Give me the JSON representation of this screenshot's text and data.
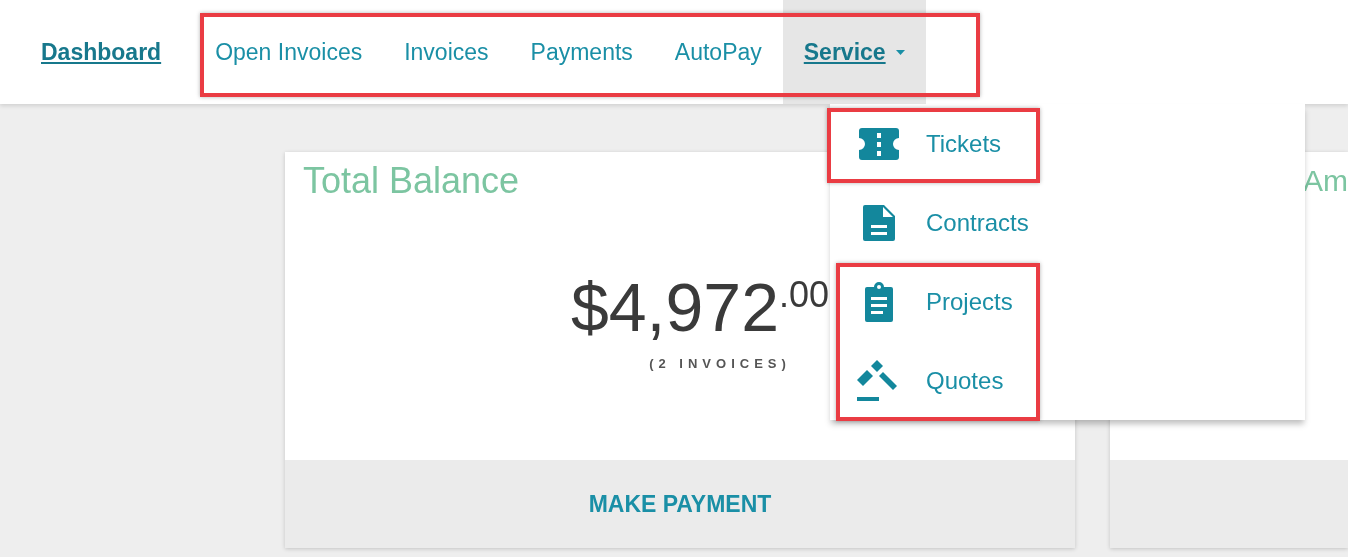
{
  "nav": [
    {
      "label": "Dashboard",
      "selected": true,
      "kind": "link"
    },
    {
      "label": "Open Invoices",
      "selected": false,
      "kind": "link"
    },
    {
      "label": "Invoices",
      "selected": false,
      "kind": "link"
    },
    {
      "label": "Payments",
      "selected": false,
      "kind": "link"
    },
    {
      "label": "AutoPay",
      "selected": false,
      "kind": "link"
    },
    {
      "label": "Service",
      "selected": true,
      "kind": "open-menu"
    }
  ],
  "menu": [
    {
      "label": "Tickets",
      "kind": "ticket"
    },
    {
      "label": "Contracts",
      "kind": "document"
    },
    {
      "label": "Projects",
      "kind": "clipboard"
    },
    {
      "label": "Quotes",
      "kind": "gavel"
    }
  ],
  "cards": [
    {
      "title": "Total Balance",
      "amount": "$4,972$^{.00}$",
      "note": "(2 INVOICES)",
      "action": "MAKE PAYMENT"
    },
    {
      "title": "Am"
    }
  ]
}
